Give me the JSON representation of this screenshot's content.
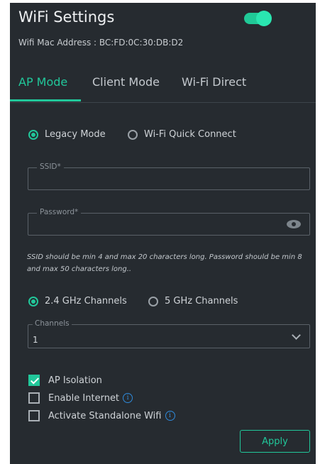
{
  "header": {
    "title": "WiFi Settings",
    "mac_address": "Wifi Mac Address : BC:FD:0C:30:DB:D2",
    "wifi_enabled": true
  },
  "tabs": [
    {
      "label": "AP Mode",
      "active": true
    },
    {
      "label": "Client Mode",
      "active": false
    },
    {
      "label": "Wi-Fi Direct",
      "active": false
    }
  ],
  "mode": {
    "options": [
      {
        "label": "Legacy Mode",
        "selected": true
      },
      {
        "label": "Wi-Fi Quick Connect",
        "selected": false
      }
    ]
  },
  "ssid": {
    "label": "SSID*",
    "value": ""
  },
  "password": {
    "label": "Password*",
    "value": ""
  },
  "hint": "SSID should be min 4 and max 20 characters long. Password should be min 8 and max 50 characters long..",
  "band": {
    "options": [
      {
        "label": "2.4 GHz Channels",
        "selected": true
      },
      {
        "label": "5 GHz Channels",
        "selected": false
      }
    ]
  },
  "channels": {
    "label": "Channels",
    "value": "1"
  },
  "options": [
    {
      "label": "AP Isolation",
      "checked": true,
      "info": false
    },
    {
      "label": "Enable Internet",
      "checked": false,
      "info": true
    },
    {
      "label": "Activate Standalone Wifi",
      "checked": false,
      "info": true
    }
  ],
  "apply_label": "Apply",
  "colors": {
    "accent": "#21c79a",
    "panel": "#262b30",
    "info": "#2f8bdc"
  }
}
